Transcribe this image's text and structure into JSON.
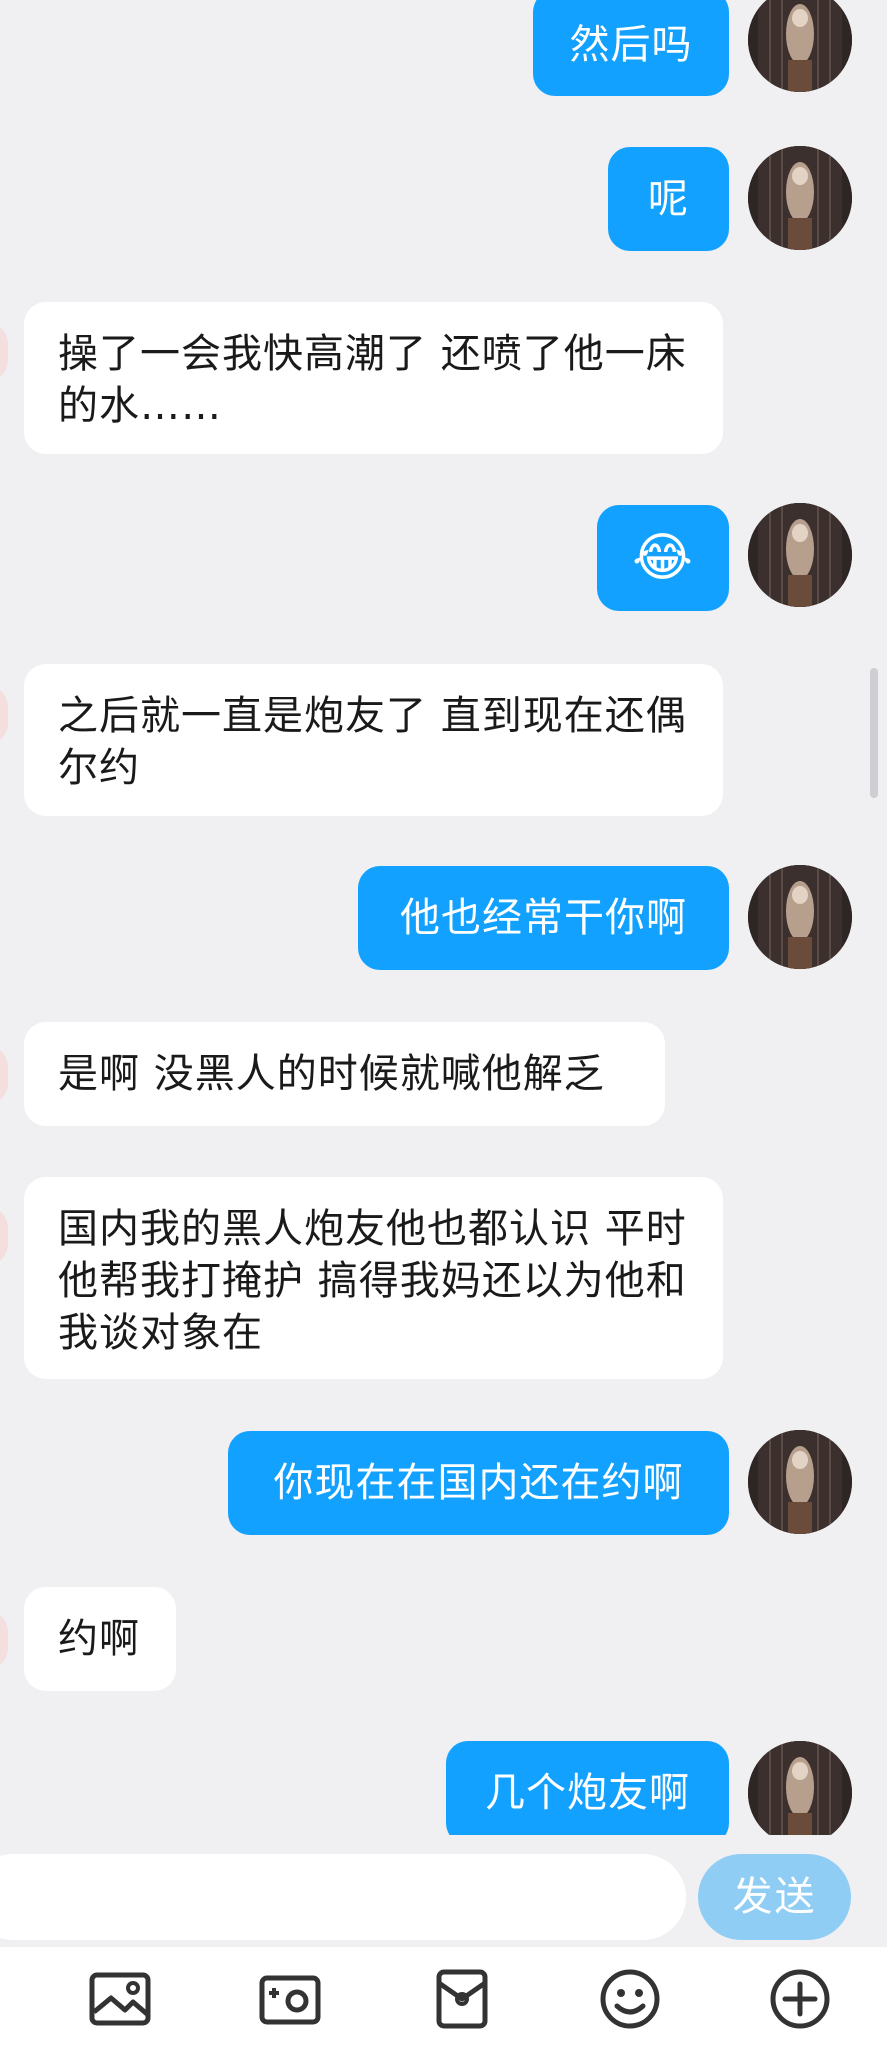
{
  "messages": [
    {
      "side": "out",
      "text": "然后吗"
    },
    {
      "side": "out",
      "text": "呢"
    },
    {
      "side": "in",
      "text": "操了一会我快高潮了 还喷了他一床的水……"
    },
    {
      "side": "out",
      "text": "😂"
    },
    {
      "side": "in",
      "text": "之后就一直是炮友了 直到现在还偶尔约"
    },
    {
      "side": "out",
      "text": "他也经常干你啊"
    },
    {
      "side": "in",
      "text": "是啊 没黑人的时候就喊他解乏"
    },
    {
      "side": "in",
      "text": "国内我的黑人炮友他也都认识 平时他帮我打掩护 搞得我妈还以为他和我谈对象在"
    },
    {
      "side": "out",
      "text": "你现在在国内还在约啊"
    },
    {
      "side": "in",
      "text": "约啊"
    },
    {
      "side": "out",
      "text": "几个炮友啊"
    }
  ],
  "composer": {
    "input_value": "",
    "send_label": "发送"
  },
  "toolbar": {
    "icons": [
      "image-icon",
      "camera-icon",
      "red-packet-icon",
      "emoji-icon",
      "plus-icon"
    ]
  },
  "colors": {
    "background": "#f0f0f2",
    "outgoing_bubble": "#12a1ff",
    "incoming_bubble": "#ffffff",
    "send_button": "#8fcdf5"
  }
}
